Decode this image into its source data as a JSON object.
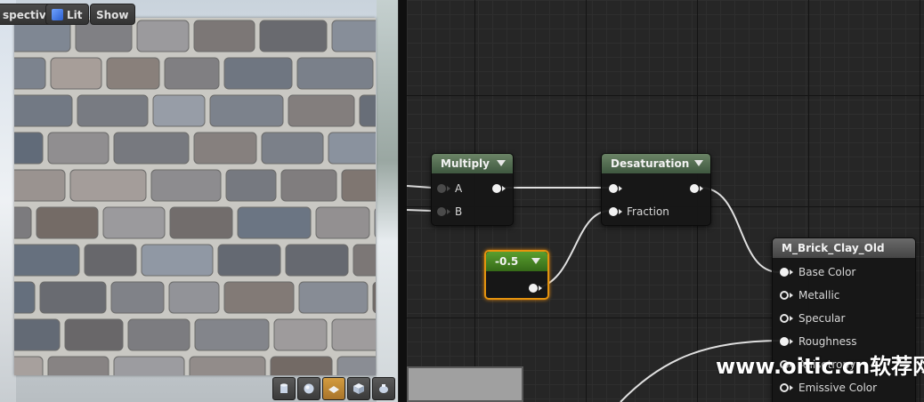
{
  "viewport": {
    "toolbar": {
      "perspective_label": "spective",
      "lit_label": "Lit",
      "show_label": "Show"
    },
    "preview_shapes": [
      {
        "name": "cylinder-preview",
        "icon": "cylinder-icon",
        "active": false
      },
      {
        "name": "sphere-preview",
        "icon": "sphere-icon",
        "active": false
      },
      {
        "name": "plane-preview",
        "icon": "plane-icon",
        "active": true
      },
      {
        "name": "cube-preview",
        "icon": "cube-icon",
        "active": false
      },
      {
        "name": "custom-mesh-preview",
        "icon": "teapot-icon",
        "active": false
      }
    ]
  },
  "graph": {
    "nodes": {
      "multiply": {
        "title": "Multiply",
        "inputs": [
          "A",
          "B"
        ]
      },
      "desaturation": {
        "title": "Desaturation",
        "inputs": [
          "",
          "Fraction"
        ]
      },
      "constant": {
        "title": "-0.5"
      },
      "material": {
        "title": "M_Brick_Clay_Old",
        "inputs": [
          "Base Color",
          "Metallic",
          "Specular",
          "Roughness",
          "Anisotropy",
          "Emissive Color"
        ]
      }
    }
  },
  "watermark": "www.oitic.cn软荐网",
  "colors": {
    "selection_orange": "#e5930e",
    "wire": "#e0e0e0",
    "grid_bg": "#262626"
  }
}
